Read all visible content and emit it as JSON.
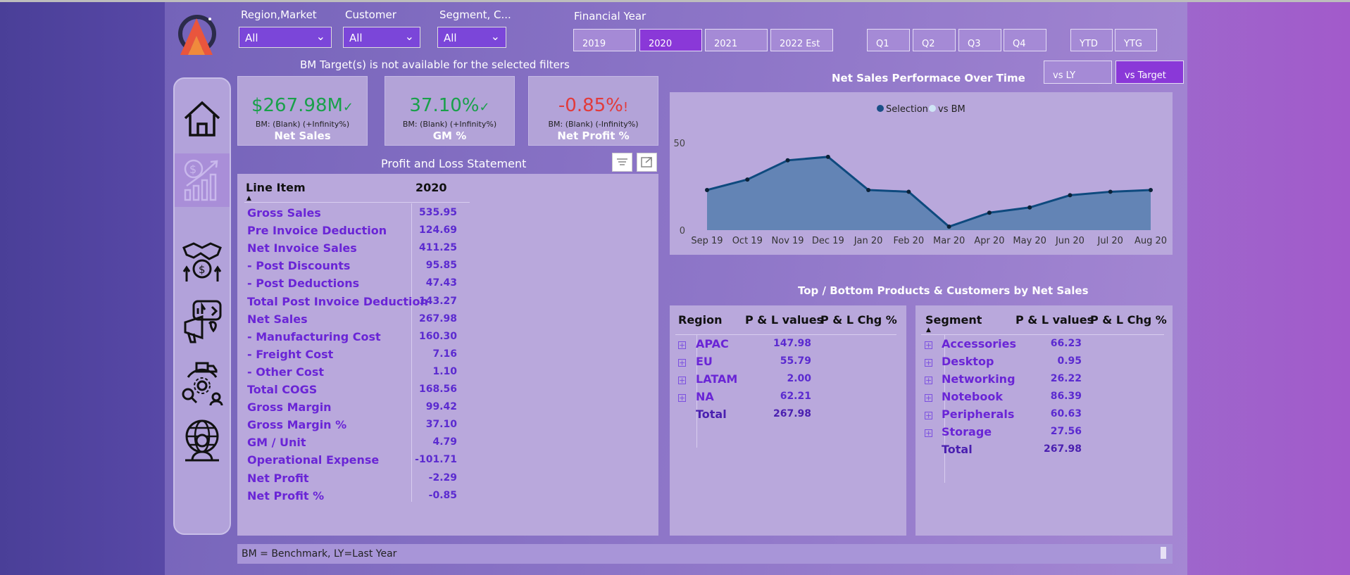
{
  "filters": {
    "region": {
      "label": "Region,Market",
      "value": "All"
    },
    "customer": {
      "label": "Customer",
      "value": "All"
    },
    "segment": {
      "label": "Segment, C...",
      "value": "All"
    }
  },
  "financial_year": {
    "label": "Financial Year",
    "years": [
      "2019",
      "2020",
      "2021",
      "2022 Est"
    ],
    "selected": "2020"
  },
  "quarters": [
    "Q1",
    "Q2",
    "Q3",
    "Q4"
  ],
  "period_buttons": [
    "YTD",
    "YTG"
  ],
  "compare_buttons": [
    "vs LY",
    "vs Target"
  ],
  "compare_selected": "vs Target",
  "bm_notice": "BM Target(s) is not available for the selected filters",
  "kpis": [
    {
      "value": "$267.98M",
      "mark": "✓",
      "sub": "BM: (Blank) (+Infinity%)",
      "label": "Net Sales",
      "color": "#19a04a"
    },
    {
      "value": "37.10%",
      "mark": "✓",
      "sub": "BM: (Blank) (+Infinity%)",
      "label": "GM %",
      "color": "#19a04a"
    },
    {
      "value": "-0.85%",
      "mark": "!",
      "sub": "BM: (Blank) (-Infinity%)",
      "label": "Net Profit %",
      "color": "#e23a3a"
    }
  ],
  "pl": {
    "title": "Profit and Loss Statement",
    "col_line": "Line Item",
    "col_year": "2020",
    "rows": [
      {
        "name": "Gross Sales",
        "value": "535.95"
      },
      {
        "name": "Pre Invoice Deduction",
        "value": "124.69"
      },
      {
        "name": "Net Invoice Sales",
        "value": "411.25"
      },
      {
        "name": "- Post Discounts",
        "value": "95.85"
      },
      {
        "name": "- Post Deductions",
        "value": "47.43"
      },
      {
        "name": "Total Post Invoice Deduction",
        "value": "143.27"
      },
      {
        "name": "Net Sales",
        "value": "267.98"
      },
      {
        "name": "- Manufacturing Cost",
        "value": "160.30"
      },
      {
        "name": "- Freight Cost",
        "value": "7.16"
      },
      {
        "name": "- Other Cost",
        "value": "1.10"
      },
      {
        "name": "Total COGS",
        "value": "168.56"
      },
      {
        "name": "Gross Margin",
        "value": "99.42"
      },
      {
        "name": "Gross Margin %",
        "value": "37.10"
      },
      {
        "name": "GM / Unit",
        "value": "4.79"
      },
      {
        "name": "Operational Expense",
        "value": "-101.71"
      },
      {
        "name": "Net Profit",
        "value": "-2.29"
      },
      {
        "name": "Net Profit %",
        "value": "-0.85"
      }
    ]
  },
  "chart_title": "Net Sales Performace Over Time",
  "chart_data": {
    "type": "area",
    "x": [
      "Sep 19",
      "Oct 19",
      "Nov 19",
      "Dec 19",
      "Jan 20",
      "Feb 20",
      "Mar 20",
      "Apr 20",
      "May 20",
      "Jun 20",
      "Jul 20",
      "Aug 20"
    ],
    "series": [
      {
        "name": "Selection",
        "values": [
          23,
          29,
          40,
          42,
          23,
          22,
          2,
          10,
          13,
          20,
          22,
          23
        ]
      },
      {
        "name": "vs BM",
        "values": []
      }
    ],
    "yticks": [
      "0",
      "50"
    ],
    "ylim": [
      0,
      50
    ],
    "legend": "top-center",
    "colors": {
      "line": "#0e4a7e",
      "fill": "#5a7fb0",
      "legend_selection": "#1a4f86",
      "legend_bm": "#cfe5f5"
    }
  },
  "top_bottom_title": "Top / Bottom Products & Customers by Net Sales",
  "region_table": {
    "headers": [
      "Region",
      "P & L values",
      "P & L Chg %"
    ],
    "rows": [
      {
        "name": "APAC",
        "value": "147.98"
      },
      {
        "name": "EU",
        "value": "55.79"
      },
      {
        "name": "LATAM",
        "value": "2.00"
      },
      {
        "name": "NA",
        "value": "62.21"
      }
    ],
    "total_label": "Total",
    "total": "267.98"
  },
  "segment_table": {
    "headers": [
      "Segment",
      "P & L values",
      "P & L Chg %"
    ],
    "rows": [
      {
        "name": "Accessories",
        "value": "66.23"
      },
      {
        "name": "Desktop",
        "value": "0.95"
      },
      {
        "name": "Networking",
        "value": "26.22"
      },
      {
        "name": "Notebook",
        "value": "86.39"
      },
      {
        "name": "Peripherals",
        "value": "60.63"
      },
      {
        "name": "Storage",
        "value": "27.56"
      }
    ],
    "total_label": "Total",
    "total": "267.98"
  },
  "footer_note": "BM = Benchmark, LY=Last Year",
  "nav_icons": [
    "home-icon",
    "finance-growth-icon",
    "deal-handshake-icon",
    "marketing-icon",
    "supply-chain-icon",
    "executive-globe-icon"
  ]
}
